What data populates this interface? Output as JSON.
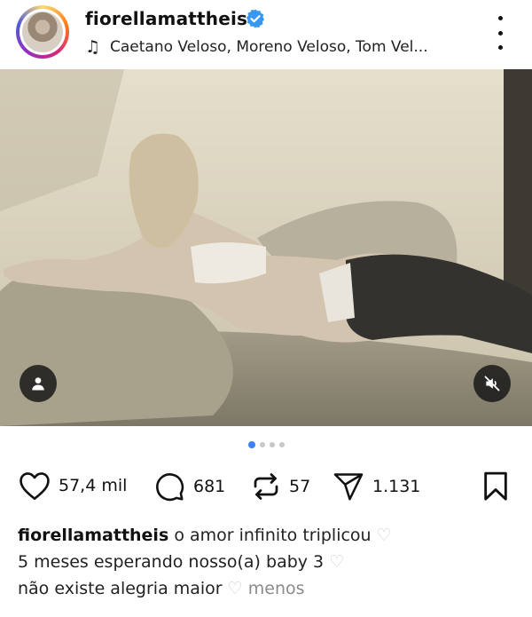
{
  "post": {
    "username": "fiorellamattheis",
    "music": "Caetano Veloso, Moreno Veloso, Tom Vel..."
  },
  "carousel": {
    "count": 4,
    "active_index": 0
  },
  "actions": {
    "likes": "57,4 mil",
    "comments": "681",
    "reposts": "57",
    "shares": "1.131"
  },
  "caption": {
    "author": "fiorellamattheis",
    "line1": "o amor infinito triplicou",
    "line2": "5 meses esperando nosso(a) baby 3",
    "line3": "não existe alegria maior",
    "more": "menos"
  },
  "colors": {
    "verified": "#3897f0",
    "active_dot": "#3b82f6"
  }
}
